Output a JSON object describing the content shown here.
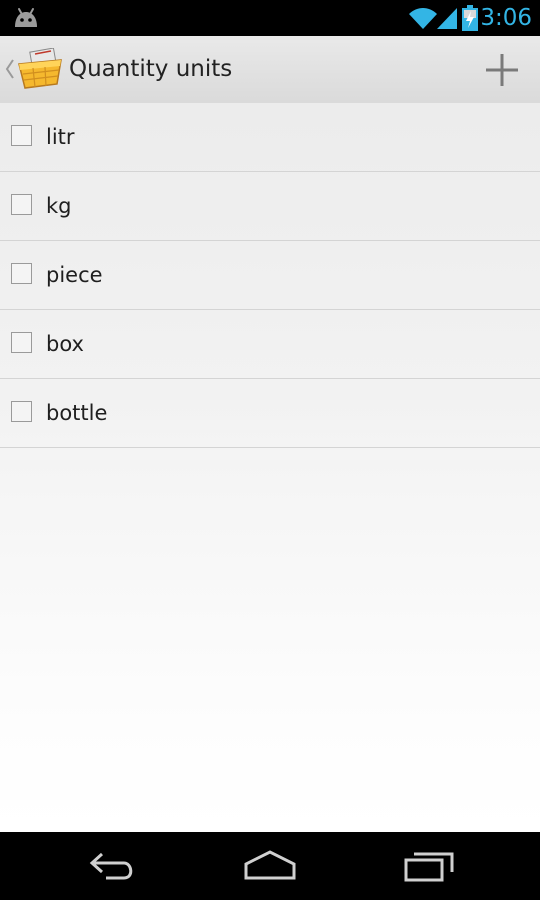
{
  "status_bar": {
    "time": "3:06",
    "icons": [
      "android-icon",
      "wifi-icon",
      "signal-icon",
      "battery-charging-icon"
    ],
    "accent_color": "#33b5e5"
  },
  "action_bar": {
    "title": "Quantity units",
    "icons": [
      "up-chevron-icon",
      "shopping-basket-icon",
      "plus-icon"
    ]
  },
  "units": {
    "items": [
      {
        "label": "litr",
        "checked": false
      },
      {
        "label": "kg",
        "checked": false
      },
      {
        "label": "piece",
        "checked": false
      },
      {
        "label": "box",
        "checked": false
      },
      {
        "label": "bottle",
        "checked": false
      }
    ]
  },
  "nav_bar": {
    "icons": [
      "back-icon",
      "home-icon",
      "recent-apps-icon"
    ]
  }
}
